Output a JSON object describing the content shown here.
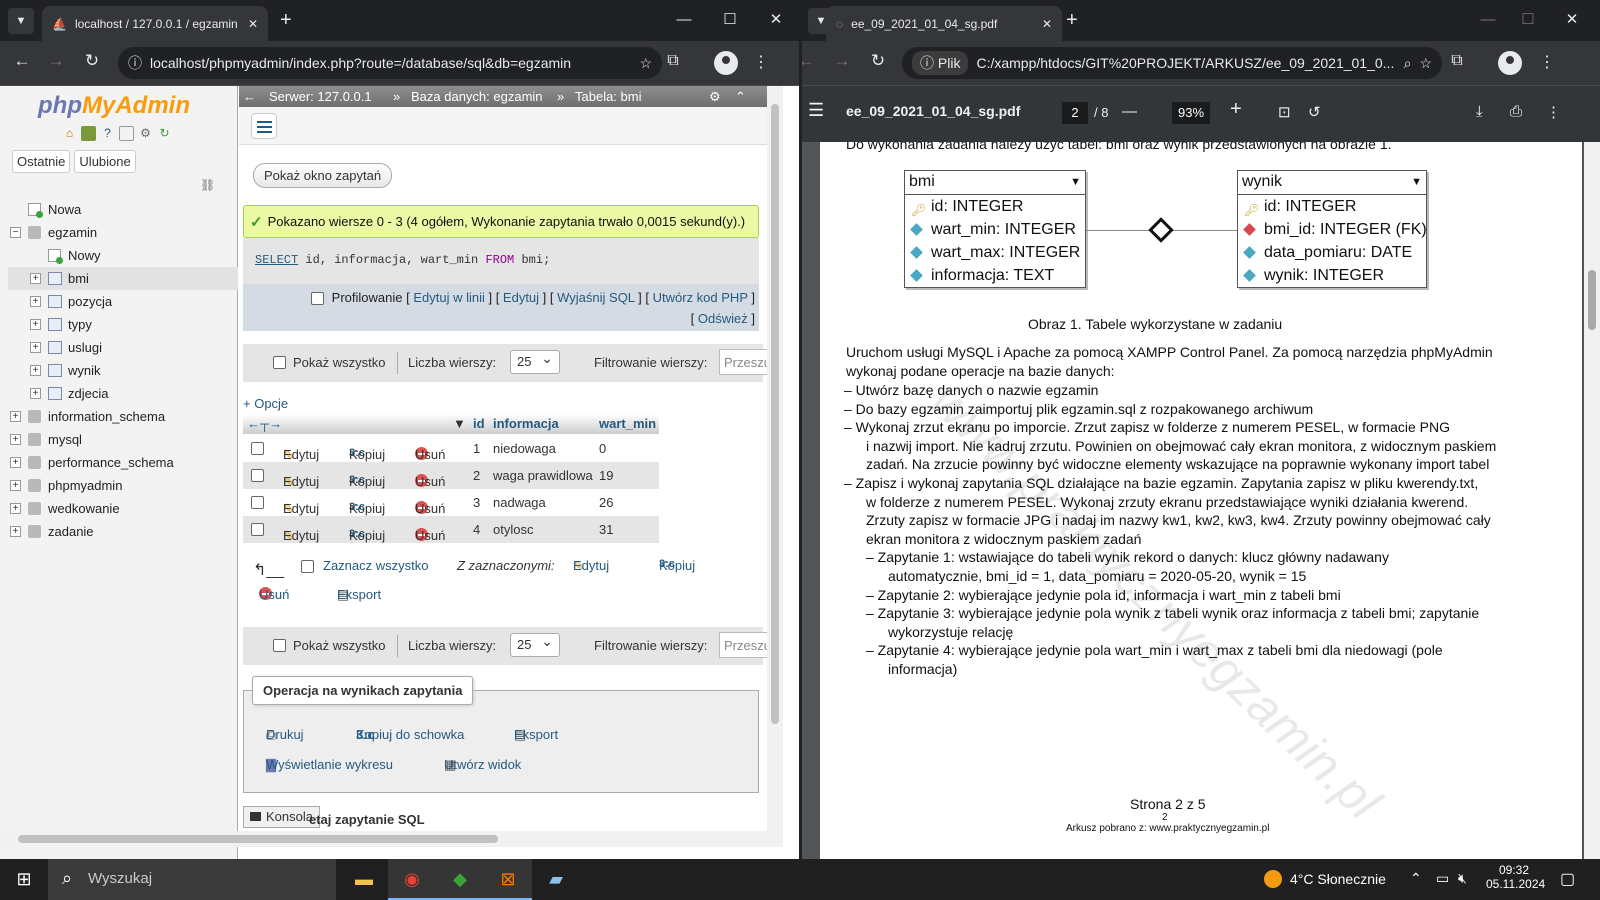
{
  "left_browser": {
    "tab_title": "localhost / 127.0.0.1 / egzamin",
    "url": "localhost/phpmyadmin/index.php?route=/database/sql&db=egzamin"
  },
  "right_browser": {
    "tab_title": "ee_09_2021_01_04_sg.pdf",
    "url_badge": "Plik",
    "url": "C:/xampp/htdocs/GIT%20PROJEKT/ARKUSZ/ee_09_2021_01_0..."
  },
  "pma": {
    "logo_php": "php",
    "logo_admin": "MyAdmin",
    "nav_tabs": [
      "Ostatnie",
      "Ulubione"
    ],
    "tree": [
      {
        "label": "Nowa",
        "level": 0,
        "kind": "new"
      },
      {
        "label": "egzamin",
        "level": 0,
        "kind": "db",
        "expanded": true
      },
      {
        "label": "Nowy",
        "level": 1,
        "kind": "new"
      },
      {
        "label": "bmi",
        "level": 1,
        "kind": "table",
        "selected": true
      },
      {
        "label": "pozycja",
        "level": 1,
        "kind": "table"
      },
      {
        "label": "typy",
        "level": 1,
        "kind": "table"
      },
      {
        "label": "uslugi",
        "level": 1,
        "kind": "table"
      },
      {
        "label": "wynik",
        "level": 1,
        "kind": "table"
      },
      {
        "label": "zdjecia",
        "level": 1,
        "kind": "table"
      },
      {
        "label": "information_schema",
        "level": 0,
        "kind": "db"
      },
      {
        "label": "mysql",
        "level": 0,
        "kind": "db"
      },
      {
        "label": "performance_schema",
        "level": 0,
        "kind": "db"
      },
      {
        "label": "phpmyadmin",
        "level": 0,
        "kind": "db"
      },
      {
        "label": "wedkowanie",
        "level": 0,
        "kind": "db"
      },
      {
        "label": "zadanie",
        "level": 0,
        "kind": "db"
      }
    ],
    "breadcrumb": {
      "server": "Serwer: 127.0.0.1",
      "database": "Baza danych: egzamin",
      "table": "Tabela: bmi"
    },
    "show_query_button": "Pokaż okno zapytań",
    "success_message": "Pokazano wiersze 0 - 3 (4 ogółem, Wykonanie zapytania trwało 0,0015 sekund(y).)",
    "sql": {
      "kw1": "SELECT",
      "cols": "id, informacja, wart_min",
      "kw2": "FROM",
      "table": "bmi;"
    },
    "sql_options": {
      "profiling": "Profilowanie",
      "edit_inline": "Edytuj w linii",
      "edit": "Edytuj",
      "explain": "Wyjaśnij SQL",
      "php_code": "Utwórz kod PHP",
      "refresh": "Odśwież"
    },
    "nav_controls": {
      "show_all": "Pokaż wszystko",
      "rows_label": "Liczba wierszy:",
      "rows_value": "25",
      "filter_label": "Filtrowanie wierszy:",
      "filter_placeholder": "Przeszukaj tę tabelę"
    },
    "options_link": "+ Opcje",
    "columns": [
      "id",
      "informacja",
      "wart_min"
    ],
    "row_actions": {
      "edit": "Edytuj",
      "copy": "Kopiuj",
      "delete": "Usuń"
    },
    "rows": [
      {
        "id": "1",
        "informacja": "niedowaga",
        "wart_min": "0"
      },
      {
        "id": "2",
        "informacja": "waga prawidlowa",
        "wart_min": "19"
      },
      {
        "id": "3",
        "informacja": "nadwaga",
        "wart_min": "26"
      },
      {
        "id": "4",
        "informacja": "otylosc",
        "wart_min": "31"
      }
    ],
    "bulk": {
      "select_all": "Zaznacz wszystko",
      "with_selected": "Z zaznaczonymi:",
      "edit": "Edytuj",
      "copy": "Kopiuj",
      "delete": "Usuń",
      "export": "Eksport"
    },
    "ops": {
      "legend": "Operacja na wynikach zapytania",
      "print": "Drukuj",
      "copy_clipboard": "Kopiuj do schowka",
      "export": "Eksport",
      "chart": "Wyświetlanie wykresu",
      "create_view": "Utwórz widok"
    },
    "console": "Konsola",
    "bookmark_partial": "etaj zapytanie SQL"
  },
  "pdf": {
    "filename": "ee_09_2021_01_04_sg.pdf",
    "page_current": "2",
    "page_total": "/ 8",
    "zoom": "93%",
    "intro": "Do wykonania zadania należy użyć tabel: bmi oraz wynik przedstawionych na obrazie 1.",
    "bmi_table": {
      "name": "bmi",
      "fields": [
        "id: INTEGER",
        "wart_min: INTEGER",
        "wart_max: INTEGER",
        "informacja: TEXT"
      ]
    },
    "wynik_table": {
      "name": "wynik",
      "fields": [
        "id: INTEGER",
        "bmi_id: INTEGER (FK)",
        "data_pomiaru: DATE",
        "wynik: INTEGER"
      ]
    },
    "caption": "Obraz 1. Tabele wykorzystane w zadaniu",
    "para1": "Uruchom usługi MySQL i Apache za pomocą XAMPP Control Panel. Za pomocą narzędzia phpMyAdmin",
    "para1b": "wykonaj podane operacje na bazie danych:",
    "lines": [
      "–   Utwórz bazę danych o nazwie egzamin",
      "–   Do bazy egzamin zaimportuj plik egzamin.sql z rozpakowanego archiwum",
      "–   Wykonaj zrzut ekranu po imporcie. Zrzut zapisz w folderze z numerem PESEL, w formacie PNG",
      "i nazwij import. Nie kadruj zrzutu. Powinien on obejmować cały ekran monitora, z widocznym paskiem",
      "zadań. Na zrzucie powinny być widoczne elementy wskazujące na poprawnie wykonany import tabel",
      "–   Zapisz i wykonaj zapytania SQL działające na bazie egzamin. Zapytania zapisz w pliku kwerendy.txt,",
      "w folderze z numerem PESEL. Wykonaj zrzuty ekranu przedstawiające wyniki działania kwerend.",
      "Zrzuty zapisz w formacie JPG i nadaj im nazwy kw1, kw2, kw3, kw4. Zrzuty powinny obejmować cały",
      "ekran monitora z widocznym paskiem zadań",
      "–   Zapytanie 1: wstawiające do tabeli wynik rekord o danych: klucz główny nadawany",
      "automatycznie, bmi_id = 1, data_pomiaru = 2020-05-20, wynik = 15",
      "–   Zapytanie 2: wybierające jedynie pola id, informacja i wart_min z tabeli bmi",
      "–   Zapytanie 3: wybierające jedynie pola wynik z tabeli wynik oraz informacja z tabeli bmi; zapytanie",
      "wykorzystuje relację",
      "–   Zapytanie 4: wybierające jedynie pola wart_min i wart_max z tabeli bmi dla niedowagi (pole",
      "informacja)"
    ],
    "footer_page": "Strona 2 z 5",
    "footer_num": "2",
    "footer_src": "Arkusz pobrano z: www.praktycznyegzamin.pl",
    "watermark": "www.praktycznyegzamin.pl"
  },
  "taskbar": {
    "search": "Wyszukaj",
    "weather": "4°C  Słonecznie",
    "time": "09:32",
    "date": "05.11.2024"
  }
}
